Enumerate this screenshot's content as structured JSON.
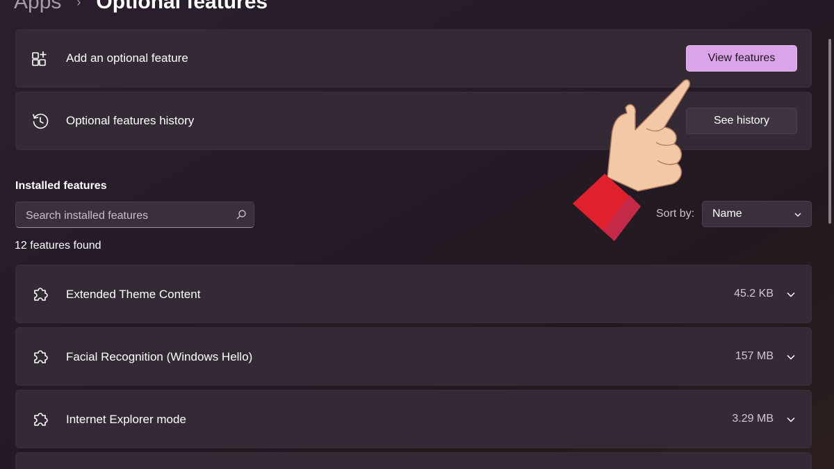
{
  "breadcrumb": {
    "parent": "Apps",
    "separator": "›",
    "current": "Optional features"
  },
  "add_feature": {
    "label": "Add an optional feature",
    "button": "View features",
    "icon": "add-apps-icon"
  },
  "history": {
    "label": "Optional features history",
    "button": "See history",
    "icon": "history-icon"
  },
  "installed": {
    "title": "Installed features",
    "search_placeholder": "Search installed features",
    "sort_label": "Sort by:",
    "sort_value": "Name",
    "count_text": "12 features found",
    "items": [
      {
        "name": "Extended Theme Content",
        "size": "45.2 KB",
        "icon": "puzzle-icon"
      },
      {
        "name": "Facial Recognition (Windows Hello)",
        "size": "157 MB",
        "icon": "puzzle-icon"
      },
      {
        "name": "Internet Explorer mode",
        "size": "3.29 MB",
        "icon": "puzzle-icon"
      }
    ]
  },
  "colors": {
    "accent_button": "#dba3e8",
    "card_bg": "#342a36",
    "page_bg": "#251b28",
    "cuff": "#e0202d"
  }
}
